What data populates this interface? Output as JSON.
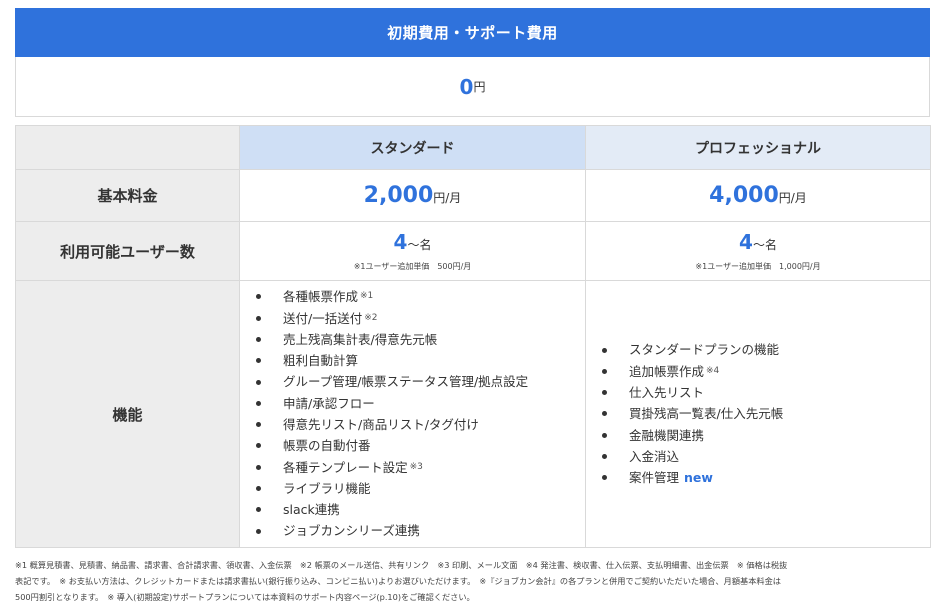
{
  "initial_cost": {
    "header": "初期費用・サポート費用",
    "value": "0",
    "unit": "円"
  },
  "plans_header": {
    "standard": "スタンダード",
    "professional": "プロフェッショナル"
  },
  "rows": {
    "base_fee_label": "基本料金",
    "users_label": "利用可能ユーザー数",
    "features_label": "機能"
  },
  "standard": {
    "price": "2,000",
    "price_unit": "円/月",
    "users": "4",
    "users_unit": "～名",
    "user_note": "※1ユーザー追加単価　500円/月",
    "features": [
      {
        "text": "各種帳票作成",
        "mark": "※1"
      },
      {
        "text": "送付/一括送付",
        "mark": "※2"
      },
      {
        "text": "売上残高集計表/得意先元帳"
      },
      {
        "text": "粗利自動計算"
      },
      {
        "text": "グループ管理/帳票ステータス管理/拠点設定"
      },
      {
        "text": "申請/承認フロー"
      },
      {
        "text": "得意先リスト/商品リスト/タグ付け"
      },
      {
        "text": "帳票の自動付番"
      },
      {
        "text": "各種テンプレート設定",
        "mark": "※3"
      },
      {
        "text": "ライブラリ機能"
      },
      {
        "text": "slack連携"
      },
      {
        "text": "ジョブカンシリーズ連携"
      }
    ]
  },
  "professional": {
    "price": "4,000",
    "price_unit": "円/月",
    "users": "4",
    "users_unit": "～名",
    "user_note": "※1ユーザー追加単価　1,000円/月",
    "features": [
      {
        "text": "スタンダードプランの機能"
      },
      {
        "text": "追加帳票作成",
        "mark": "※4"
      },
      {
        "text": "仕入先リスト"
      },
      {
        "text": "買掛残高一覧表/仕入先元帳"
      },
      {
        "text": "金融機関連携"
      },
      {
        "text": "入金消込"
      },
      {
        "text": "案件管理",
        "badge": "new"
      }
    ]
  },
  "footnotes": {
    "line1": "※1 概算見積書、見積書、納品書、請求書、合計請求書、領収書、入金伝票　※2 帳票のメール送信、共有リンク　※3 印刷、メール文面　※4 発注書、検収書、仕入伝票、支払明細書、出金伝票　※ 価格は税抜",
    "line2": "表記です。　※ お支払い方法は、クレジットカードまたは請求書払い(銀行振り込み、コンビニ払い)よりお選びいただけます。　※『ジョブカン会計』の各プランと併用でご契約いただいた場合、月額基本料金は",
    "line3": "500円割引となります。　※ 導入(初期設定)サポートプランについては本資料のサポート内容ページ(p.10)をご確認ください。"
  }
}
